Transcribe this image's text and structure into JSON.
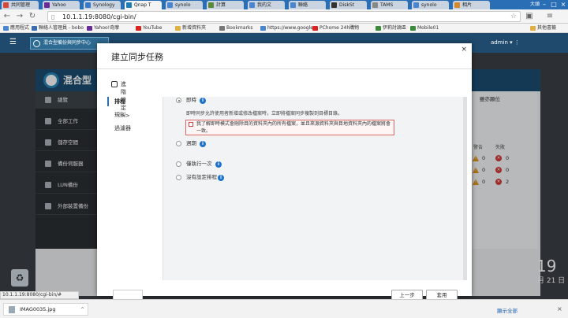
{
  "browser": {
    "tabs": [
      {
        "label": "共同管理",
        "fav": "#d34a3a"
      },
      {
        "label": "Yahoo",
        "fav": "#6a2a9a"
      },
      {
        "label": "Synology",
        "fav": "#3a78c8"
      },
      {
        "label": "Qnap T",
        "fav": "#1d7db5",
        "active": true
      },
      {
        "label": "synolo",
        "fav": "#4a86d0"
      },
      {
        "label": "計算",
        "fav": "#5a8a3a"
      },
      {
        "label": "我的文",
        "fav": "#4a86d0"
      },
      {
        "label": "聯絡",
        "fav": "#4a86d0"
      },
      {
        "label": "DiskSt",
        "fav": "#333"
      },
      {
        "label": "TAMS",
        "fav": "#888"
      },
      {
        "label": "synolo",
        "fav": "#4a86d0"
      },
      {
        "label": "相片",
        "fav": "#d48a2a"
      }
    ],
    "profile": "大頭",
    "url": "10.1.1.19:8080/cgi-bin/",
    "bookmarks": [
      {
        "label": "應用程式",
        "color": "#4a86d0"
      },
      {
        "label": "聯絡人管理員 - bobo",
        "color": "#3a6db0"
      },
      {
        "label": "Yahoo!奇摩",
        "color": "#6a2a9a"
      },
      {
        "label": "YouTube",
        "color": "#d22"
      },
      {
        "label": "新增資料夾",
        "color": "#e0b040"
      },
      {
        "label": "Bookmarks",
        "color": "#777"
      },
      {
        "label": "https://www.google",
        "color": "#4a86d0"
      },
      {
        "label": "PChome 24h購物",
        "color": "#d22"
      },
      {
        "label": "伊莉討論區",
        "color": "#3a8a3a"
      },
      {
        "label": "Mobile01",
        "color": "#3a8a3a"
      }
    ],
    "other_bookmarks": "其他書籤",
    "status_url": "10.1.1.19:8080/cgi-bin/#"
  },
  "qnap": {
    "window_title": "混合型備份與同步中心",
    "user": "admin"
  },
  "app": {
    "name": "混合型",
    "sidebar": [
      "總覽",
      "全部工作",
      "儲存空間",
      "備份伺服器",
      "LUN備份",
      "外部裝置備份"
    ],
    "right_title": "雖亦顯位",
    "col_warning": "警告",
    "col_fail": "失敗",
    "rows": [
      {
        "w": "0",
        "f": "0"
      },
      {
        "w": "0",
        "f": "0"
      },
      {
        "w": "0",
        "f": "2"
      }
    ]
  },
  "desktop": {
    "clock": "19",
    "date": "月 21 日"
  },
  "modal": {
    "title": "建立同步任務",
    "advanced": "進階設定 >>",
    "steps": [
      "排程",
      "規則",
      "過濾器"
    ],
    "options": {
      "realtime": "即時",
      "realtime_desc": "即時同步允許使用者新增或修改檔案時，立即將檔案同步複製到目標目錄。",
      "realtime_warn": "我了解即時模式會刪除目的資料夾內的所有檔案，並且來源資料夾與目地資料夾內的檔案將會一致。",
      "schedule": "週期",
      "once": "僅執行一次",
      "none": "沒有設定排程"
    },
    "prev": "上一步",
    "cancel": "套用"
  },
  "downloads": {
    "file": "IMAG0035.jpg",
    "show_all": "顯示全部"
  }
}
